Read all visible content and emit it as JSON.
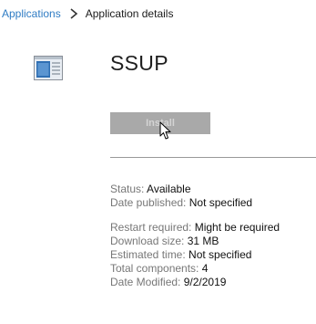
{
  "breadcrumb": {
    "root": "Applications",
    "current": "Application details"
  },
  "app": {
    "name": "SSUP",
    "icon": "application-window-icon"
  },
  "install_button": {
    "label": "Install",
    "state": "disabled"
  },
  "details": {
    "group1": [
      {
        "key": "Status:",
        "value": "Available"
      },
      {
        "key": "Date published:",
        "value": "Not specified"
      }
    ],
    "group2": [
      {
        "key": "Restart required:",
        "value": "Might be required"
      },
      {
        "key": "Download size:",
        "value": "31 MB"
      },
      {
        "key": "Estimated time:",
        "value": "Not specified"
      },
      {
        "key": "Total components:",
        "value": "4"
      },
      {
        "key": "Date Modified:",
        "value": "9/2/2019"
      }
    ]
  },
  "colors": {
    "link": "#2f7cc4",
    "button_disabled_bg": "#a9a9a9",
    "button_disabled_text": "#d4d4d4",
    "label": "#777777",
    "value": "#111111"
  }
}
